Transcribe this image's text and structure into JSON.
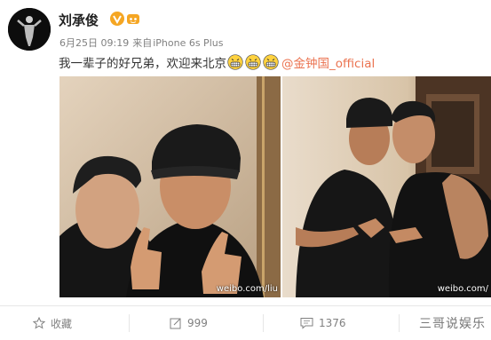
{
  "post": {
    "username": "刘承俊",
    "date": "6月25日 09:19",
    "source": "来自",
    "device": "iPhone 6s Plus",
    "text": "我一辈子的好兄弟，欢迎来北京",
    "mention": "@金钟国_official",
    "emoji": [
      "grin-emoji",
      "grin-emoji",
      "grin-emoji"
    ]
  },
  "photos": {
    "left_watermark": "weibo.com/liu",
    "right_watermark": "weibo.com/"
  },
  "actions": {
    "favorite_label": "收藏",
    "repost_count": "999",
    "comment_count": "1376"
  },
  "overlay": {
    "corner_watermark": "三哥说娱乐"
  },
  "colors": {
    "mention": "#eb7350",
    "badge_gold": "#f5a623"
  }
}
